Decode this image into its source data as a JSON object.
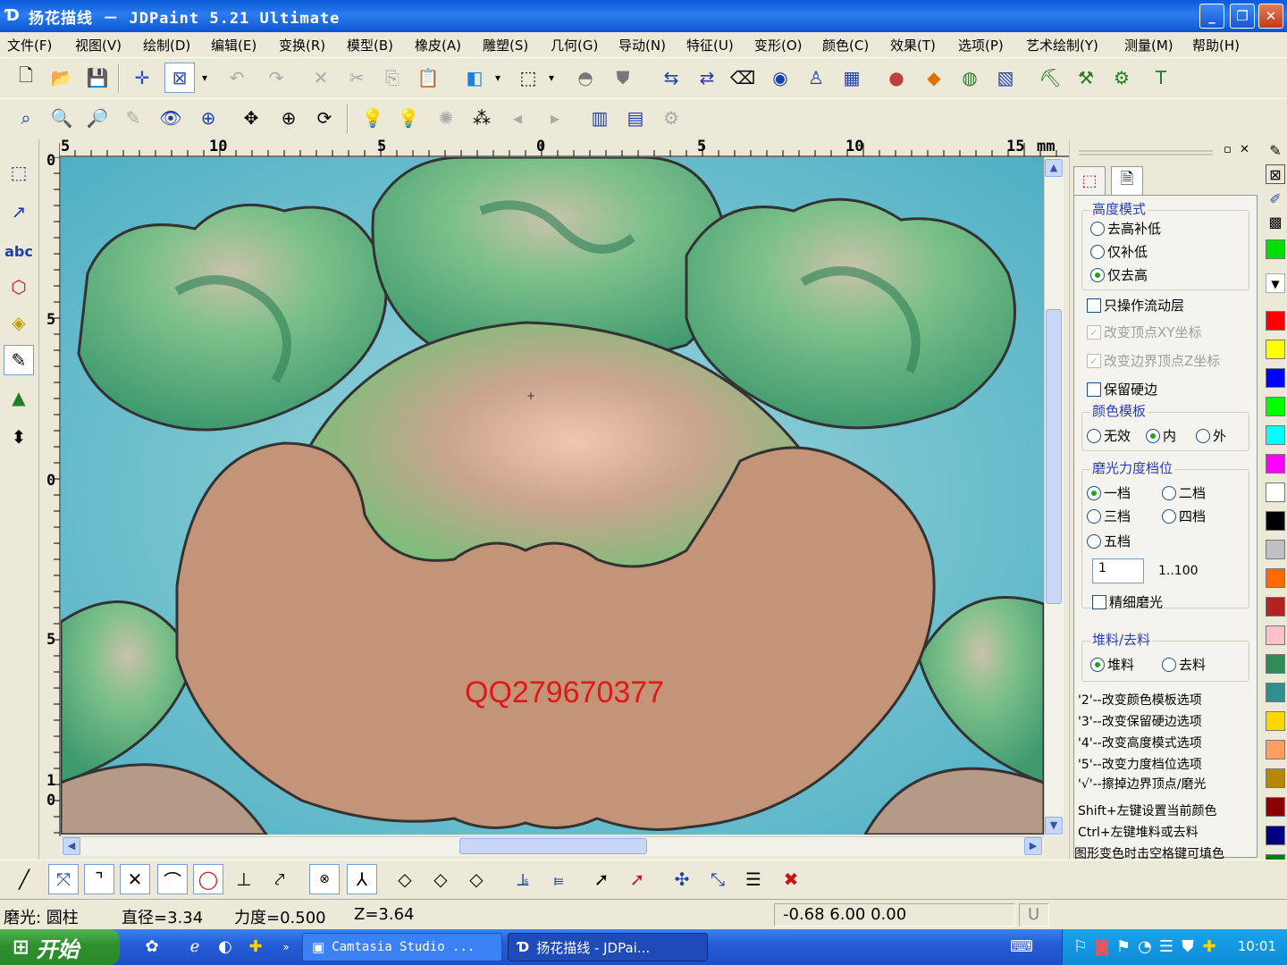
{
  "window": {
    "title": "扬花描线 － JDPaint 5.21 Ultimate",
    "minimize": "_",
    "maximize": "❐",
    "close": "✕"
  },
  "menu": [
    "文件(F)",
    "视图(V)",
    "绘制(D)",
    "编辑(E)",
    "变换(R)",
    "模型(B)",
    "橡皮(A)",
    "雕塑(S)",
    "几何(G)",
    "导动(N)",
    "特征(U)",
    "变形(O)",
    "颜色(C)",
    "效果(T)",
    "选项(P)",
    "艺术绘制(Y)",
    "测量(M)",
    "帮助(H)"
  ],
  "rulers": {
    "horizontal_labels": [
      "5",
      "10",
      "5",
      "0",
      "5",
      "10",
      "15",
      "mm"
    ],
    "vertical_labels": [
      "0",
      "5",
      "0",
      "5",
      "1",
      "0"
    ]
  },
  "viewport": {
    "watermark": "QQ279670377",
    "cursor": "+"
  },
  "panel": {
    "height_mode": {
      "title": "高度模式",
      "options": [
        {
          "label": "去高补低",
          "selected": false
        },
        {
          "label": "仅补低",
          "selected": false
        },
        {
          "label": "仅去高",
          "selected": true
        }
      ]
    },
    "checkboxes": [
      {
        "label": "只操作流动层",
        "checked": false,
        "enabled": true
      },
      {
        "label": "改变顶点XY坐标",
        "checked": true,
        "enabled": false
      },
      {
        "label": "改变边界顶点Z坐标",
        "checked": true,
        "enabled": false
      },
      {
        "label": "保留硬边",
        "checked": false,
        "enabled": true
      }
    ],
    "color_template": {
      "title": "颜色模板",
      "options": [
        {
          "label": "无效",
          "selected": false
        },
        {
          "label": "内",
          "selected": true
        },
        {
          "label": "外",
          "selected": false
        }
      ]
    },
    "polish_level": {
      "title": "磨光力度档位",
      "options": [
        {
          "label": "一档",
          "selected": true
        },
        {
          "label": "二档",
          "selected": false
        },
        {
          "label": "三档",
          "selected": false
        },
        {
          "label": "四档",
          "selected": false
        },
        {
          "label": "五档",
          "selected": false
        }
      ],
      "value": "1",
      "range": "1..100",
      "fine_polish": {
        "label": "精细磨光",
        "checked": false
      }
    },
    "material": {
      "title": "堆料/去料",
      "options": [
        {
          "label": "堆料",
          "selected": true
        },
        {
          "label": "去料",
          "selected": false
        }
      ]
    },
    "hints": [
      "'2'--改变颜色模板选项",
      "'3'--改变保留硬边选项",
      "'4'--改变高度模式选项",
      "'5'--改变力度档位选项",
      "'√'--擦掉边界顶点/磨光",
      "Shift+左键设置当前颜色",
      "Ctrl+左键堆料或去料",
      "图形变色时击空格键可填色"
    ]
  },
  "palette": {
    "colors": [
      "#00e000",
      "#ff0000",
      "#ffff00",
      "#0000ff",
      "#00ff00",
      "#00ffff",
      "#ff00ff",
      "#ffffff",
      "#000000",
      "#c0c0c0",
      "#ff6a00",
      "#b22222",
      "#ffc0cb",
      "#2e8b57",
      "#2f8f8f",
      "#ffd700",
      "#ffa060",
      "#b8860b",
      "#8b0000",
      "#000080",
      "#008000",
      "#008b8b",
      "#4b0082"
    ]
  },
  "status": {
    "tool": "磨光: 圆柱",
    "diameter": "直径=3.34",
    "force": "力度=0.500",
    "z": "Z=3.64",
    "coords": "-0.68  6.00  0.00",
    "mode": "U"
  },
  "taskbar": {
    "start": "开始",
    "tasks": [
      "Camtasia Studio ...",
      "扬花描线 - JDPai..."
    ],
    "clock": "10:01"
  }
}
